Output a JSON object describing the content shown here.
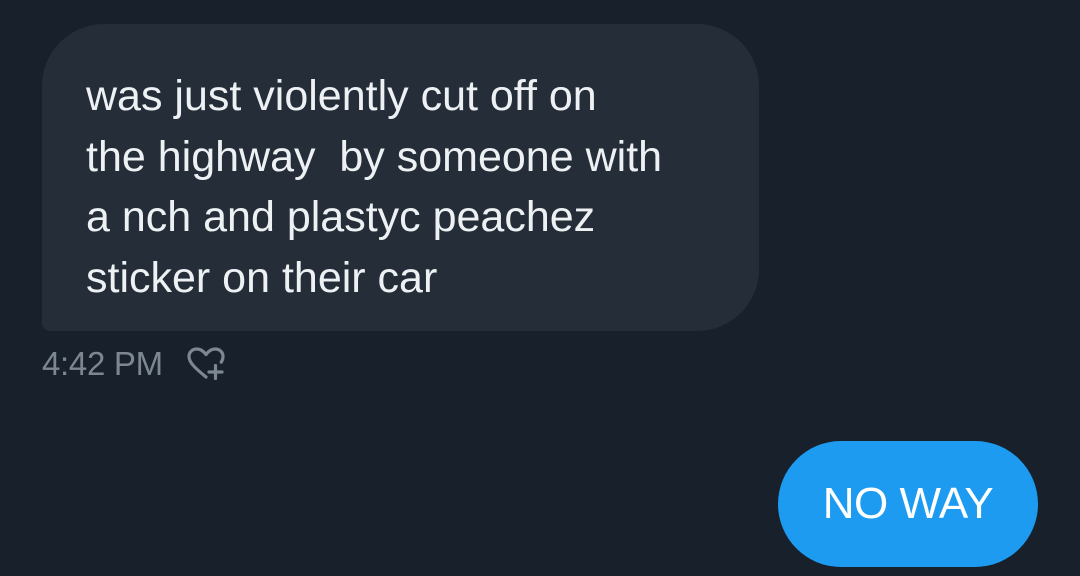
{
  "conversation": {
    "received": {
      "lines": [
        "was just violently cut off on",
        "the highway  by someone with",
        "a nch and plastyc peachez",
        "sticker on their car"
      ],
      "timestamp": "4:42 PM",
      "reaction_icon": "heart-plus-icon"
    },
    "sent": {
      "text": "NO WAY"
    }
  },
  "colors": {
    "background": "#18212b",
    "received_bubble": "#252e38",
    "sent_bubble": "#1d9bf0",
    "timestamp": "#7c8791"
  }
}
